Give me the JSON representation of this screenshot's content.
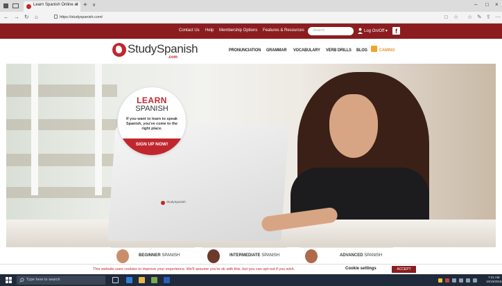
{
  "browser": {
    "tab_title": "Learn Spanish Online at",
    "tab_close": "×",
    "new_tab": "+",
    "tab_dropdown": "∨",
    "url": "https://studyspanish.com/",
    "window_controls": {
      "minimize": "–",
      "maximize": "□",
      "close": "×"
    },
    "nav_icons": {
      "back": "←",
      "forward": "→",
      "refresh": "↻",
      "home": "⌂"
    },
    "tool_icons": {
      "reading": "□",
      "favorite": "☆",
      "favorites_bar": "☆",
      "pen": "✎",
      "share": "⇪",
      "more": "⋯"
    }
  },
  "topbar": {
    "links": [
      "Contact Us",
      "Help",
      "Membership Options",
      "Features & Resources"
    ],
    "search_placeholder": "Search",
    "login_label": "Log On/Off ▾",
    "facebook": "f",
    "bg_color": "#8b1d20"
  },
  "header": {
    "logo_main": "StudySpanish",
    "logo_suffix": ".com",
    "nav": [
      "PRONUNCIATION",
      "GRAMMAR",
      "VOCABULARY",
      "VERB DRILLS",
      "BLOG",
      "CAMINO"
    ]
  },
  "hero": {
    "learn": "LEARN",
    "spanish": "SPANISH",
    "tagline": "If you want to learn to speak Spanish, you've come to the right place.",
    "signup": "SIGN UP NOW!",
    "laptop_logo": "StudySpanish",
    "accent": "#c0272d"
  },
  "levels": [
    {
      "strong": "BEGINNER",
      "rest": " SPANISH"
    },
    {
      "strong": "INTERMEDIATE",
      "rest": " SPANISH"
    },
    {
      "strong": "ADVANCED",
      "rest": " SPANISH"
    }
  ],
  "cookie": {
    "text": "This website uses cookies to improve your experience. We'll assume you're ok with this, but you can opt-out if you wish.",
    "settings": "Cookie settings",
    "accept": "ACCEPT"
  },
  "taskbar": {
    "search_placeholder": "Type here to search",
    "time": "7:41 AM",
    "date": "10/19/2018"
  }
}
